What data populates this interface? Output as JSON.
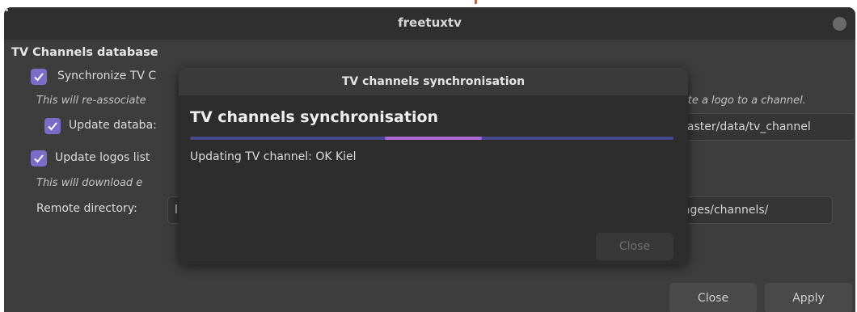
{
  "window": {
    "title": "freetuxtv"
  },
  "content": {
    "section_heading": "TV Channels database",
    "sync_checkbox_label": "Synchronize TV C",
    "sync_checked": true,
    "reassociate_note": "This will re-associate",
    "associate_logo_note": "ciate a logo to a channel.",
    "update_db_label": "Update databa:",
    "update_db_checked": true,
    "db_url_value": "naster/data/tv_channel",
    "update_logos_label": "Update logos list",
    "update_logos_checked": true,
    "download_note": "This will download e",
    "remote_dir_label": "Remote directory:",
    "remote_dir_value_left": "l",
    "remote_dir_value_right": "iages/channels/"
  },
  "buttons": {
    "close_label": "Close",
    "apply_label": "Apply"
  },
  "dialog": {
    "title": "TV channels synchronisation",
    "heading": "TV channels synchronisation",
    "status": "Updating TV channel: OK Kiel",
    "progress_type": "activity",
    "close_label": "Close",
    "close_enabled": false
  },
  "colors": {
    "accent": "#7a6cc7",
    "progress_pulse": "#b06ad6",
    "progress_track": "#464a8c"
  }
}
